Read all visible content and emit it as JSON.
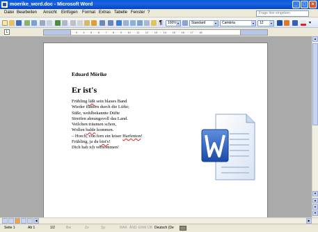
{
  "window": {
    "title": "moerike_word.doc - Microsoft Word",
    "controls": [
      "_",
      "□",
      "×"
    ]
  },
  "menu": {
    "items": [
      "Datei",
      "Bearbeiten",
      "Ansicht",
      "Einfügen",
      "Format",
      "Extras",
      "Tabelle",
      "Fenster",
      "?"
    ],
    "help_placeholder": "Frage hier eingeben"
  },
  "toolbar": {
    "zoom": "100%",
    "style": "Standard",
    "font": "Cambria",
    "size": "12"
  },
  "ruler": {
    "ticks": "2 · · · 1 · · · 1 · · · 2 · · · 3 · · · 4 · · · 5 · · · 6 · · · 7 · · · 8 · · · 9 · · · 10 · · · 11 · · · 12 · · · 13 · · · 14 · · · 15 · · · 16 · · · 17 · · · 18"
  },
  "document": {
    "author": "Eduard Mörike",
    "title": "Er ist's",
    "lines": [
      {
        "parts": [
          {
            "t": "Frühling "
          },
          {
            "t": "läßt",
            "err": true
          },
          {
            "t": " sein blaues Band"
          }
        ]
      },
      {
        "parts": [
          {
            "t": "Wieder flattern durch die Lüfte;"
          }
        ]
      },
      {
        "parts": [
          {
            "t": "Süße, wohlbekannte Düfte"
          }
        ]
      },
      {
        "parts": [
          {
            "t": "Streifen ahnungsvoll das Land."
          }
        ]
      },
      {
        "parts": [
          {
            "t": "Veilchen träumen schon,"
          }
        ]
      },
      {
        "parts": [
          {
            "t": "Wollen "
          },
          {
            "t": "balde",
            "err": true
          },
          {
            "t": " kommen."
          }
        ]
      },
      {
        "parts": [
          {
            "t": "– Horch, von fern ein leiser "
          },
          {
            "t": "Harfenton",
            "err": true
          },
          {
            "t": "!"
          }
        ]
      },
      {
        "parts": [
          {
            "t": "Frühling, ja du "
          },
          {
            "t": "bist's",
            "err": true
          },
          {
            "t": "!"
          }
        ]
      },
      {
        "parts": [
          {
            "t": "Dich hab ich vernommen!"
          }
        ]
      }
    ]
  },
  "status": {
    "page": "Seite 1",
    "section": "Ab 1",
    "pages": "1/2",
    "at": "Bei",
    "line": "Ze",
    "col": "Sp",
    "mak": "MAK",
    "and": "ÄND",
    "erw": "ERW",
    "ub": "ÜB",
    "lang": "Deutsch (De"
  }
}
